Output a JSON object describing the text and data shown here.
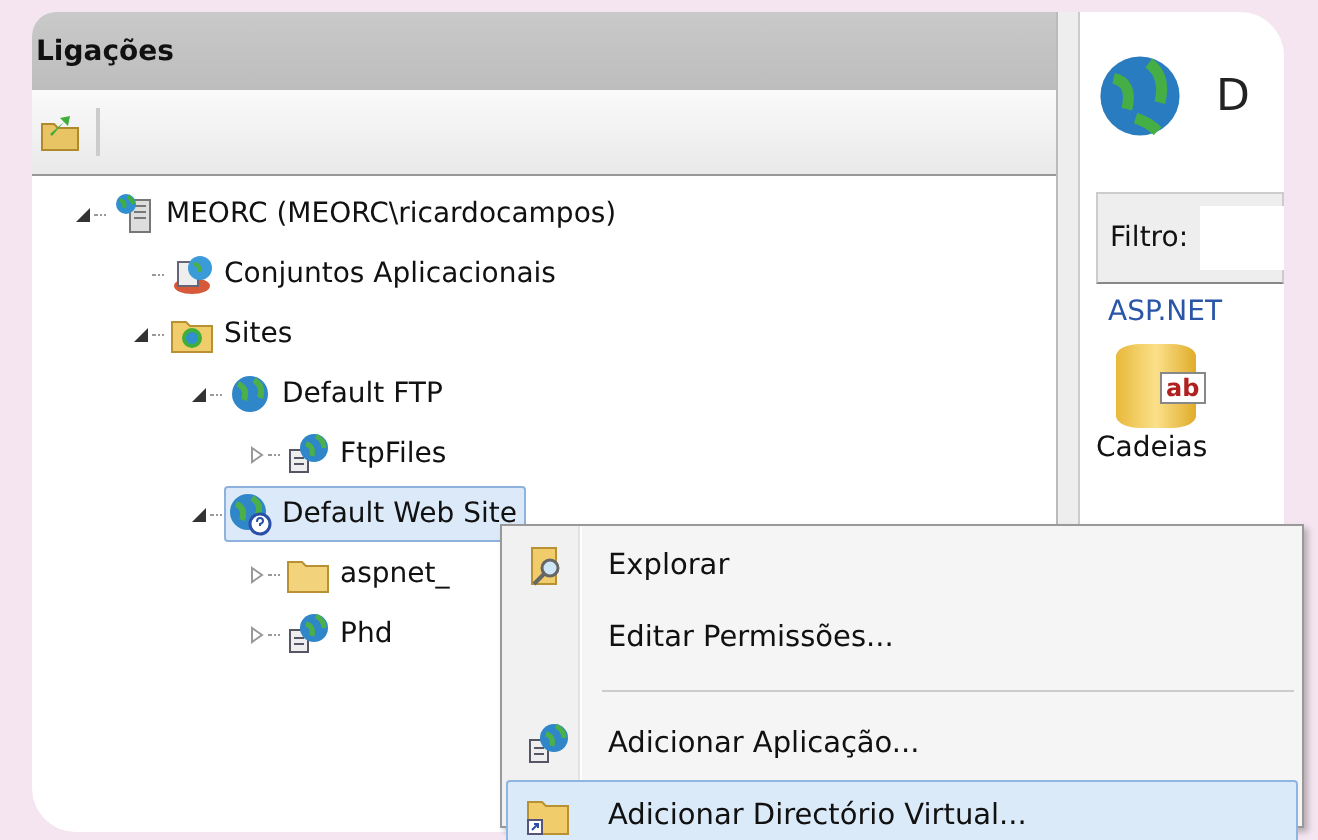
{
  "connections_panel": {
    "title": "Ligações",
    "tree": [
      {
        "label": "MEORC (MEORC\\ricardocampos)",
        "kind": "server",
        "expanded": true,
        "selected": false,
        "children": [
          {
            "label": "Conjuntos Aplicacionais",
            "kind": "pool",
            "selected": false
          },
          {
            "label": "Sites",
            "kind": "sites",
            "expanded": true,
            "selected": false,
            "children": [
              {
                "label": "Default FTP",
                "kind": "globe",
                "expanded": true,
                "selected": false,
                "children": [
                  {
                    "label": "FtpFiles",
                    "kind": "app",
                    "expanded": false,
                    "selected": false
                  }
                ]
              },
              {
                "label": "Default Web Site",
                "kind": "website",
                "expanded": true,
                "selected": true,
                "children": [
                  {
                    "label": "aspnet_",
                    "kind": "folder",
                    "expanded": false,
                    "selected": false
                  },
                  {
                    "label": "Phd",
                    "kind": "app",
                    "expanded": false,
                    "selected": false
                  }
                ]
              }
            ]
          }
        ]
      }
    ]
  },
  "main_panel": {
    "title": "D",
    "filter_label": "Filtro:",
    "group": "ASP.NET",
    "feature_icon_text": "ab",
    "feature": "Cadeias"
  },
  "context_menu": [
    {
      "kind": "explore",
      "label": "Explorar",
      "selected": false
    },
    {
      "kind": "plain",
      "label": "Editar Permissões...",
      "selected": false
    },
    {
      "kind": "separator"
    },
    {
      "kind": "app",
      "label": "Adicionar Aplicação...",
      "selected": false
    },
    {
      "kind": "vdir",
      "label": "Adicionar Directório Virtual...",
      "selected": true
    }
  ]
}
